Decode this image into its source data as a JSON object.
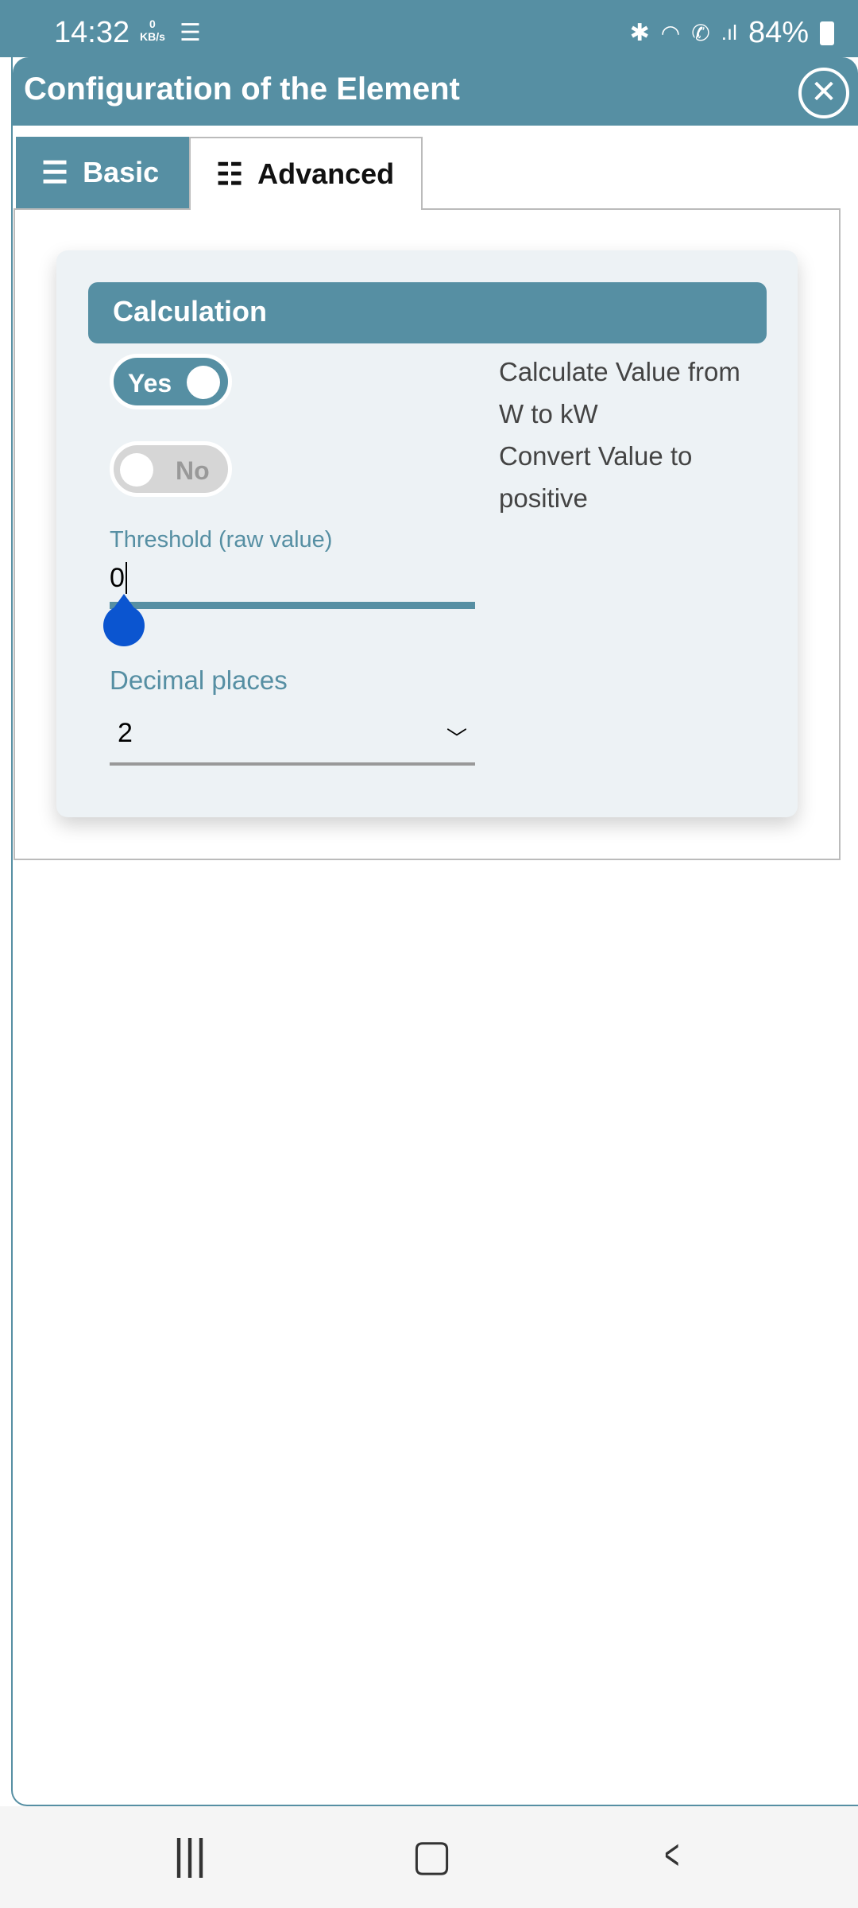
{
  "status_bar": {
    "time": "14:32",
    "net_speed": "0",
    "net_unit": "KB/s",
    "battery": "84%",
    "icons": [
      "android-debug-icon",
      "bluetooth-icon",
      "wifi-icon",
      "wifi-call-icon",
      "signal-icon",
      "battery-icon"
    ]
  },
  "dialog": {
    "title": "Configuration of the Element",
    "close_icon": "close-circle-icon"
  },
  "tabs": [
    {
      "label": "Basic",
      "icon": "list-icon",
      "active": false
    },
    {
      "label": "Advanced",
      "icon": "list-add-icon",
      "active": true
    }
  ],
  "section": {
    "title": "Calculation",
    "toggles": [
      {
        "label": "Yes",
        "on": true,
        "description": "Calculate Value from W to kW"
      },
      {
        "label": "No",
        "on": false,
        "description": "Convert Value to positive"
      }
    ],
    "threshold": {
      "label": "Threshold (raw value)",
      "value": "0",
      "slider_value": 0
    },
    "decimal": {
      "label": "Decimal places",
      "value": "2"
    }
  },
  "colors": {
    "primary": "#568fa3",
    "slider_thumb": "#0b55d0",
    "card_bg": "#edf2f5"
  },
  "nav": {
    "recents": "|||",
    "home": "▢",
    "back": "<"
  }
}
